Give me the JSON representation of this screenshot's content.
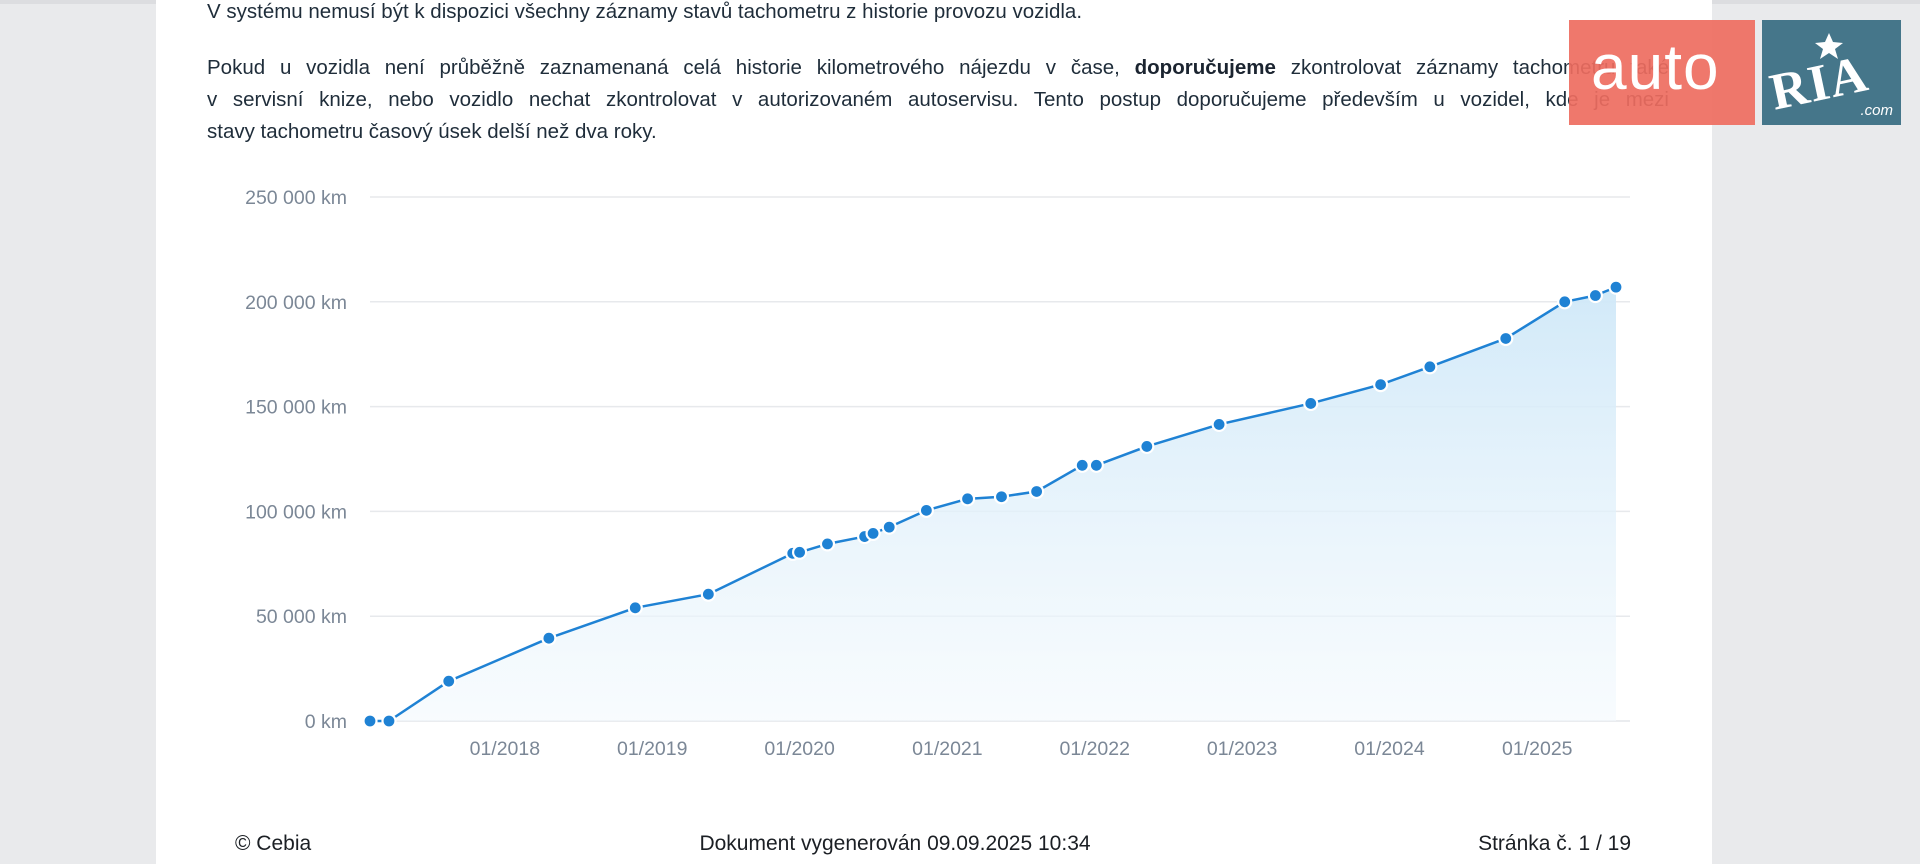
{
  "document": {
    "paragraph1": "V systému nemusí být k dispozici všechny záznamy stavů tachometru z historie provozu vozidla.",
    "paragraph2": {
      "line1_start": "Pokud u vozidla není průběžně zaznamenaná celá historie kilometrového nájezdu v čase, ",
      "line1_bold": "doporučujeme",
      "line1_end": " zkontrolovat záznamy tachometru také",
      "line2": "v servisní knize, nebo vozidlo nechat zkontrolovat v autorizovaném autoservisu. Tento postup doporučujeme především u vozidel, kde je mezi",
      "line3": "stavy tachometru časový úsek delší než dva roky."
    }
  },
  "chart_data": {
    "type": "area",
    "y_unit": "km",
    "ylim": [
      0,
      250000
    ],
    "y_ticks": [
      0,
      50000,
      100000,
      150000,
      200000,
      250000
    ],
    "y_tick_labels": [
      "0 km",
      "50 000 km",
      "100 000 km",
      "150 000 km",
      "200 000 km",
      "250 000 km"
    ],
    "xlim": [
      "2017-02-01",
      "2025-07-15"
    ],
    "x_tick_labels": [
      "01/2018",
      "01/2019",
      "01/2020",
      "01/2021",
      "01/2022",
      "01/2023",
      "01/2024",
      "01/2025"
    ],
    "x_ticks": [
      "2018-01-01",
      "2019-01-01",
      "2020-01-01",
      "2021-01-01",
      "2022-01-01",
      "2023-01-01",
      "2024-01-01",
      "2025-01-01"
    ],
    "grid": true,
    "colors": {
      "line": "#1f82d4",
      "fill": "#d4ecf9"
    },
    "points": [
      {
        "x": "2017-02-01",
        "y": 0
      },
      {
        "x": "2017-03-20",
        "y": 0
      },
      {
        "x": "2017-08-15",
        "y": 19000
      },
      {
        "x": "2018-04-20",
        "y": 39500
      },
      {
        "x": "2018-11-20",
        "y": 54000
      },
      {
        "x": "2019-05-20",
        "y": 60500
      },
      {
        "x": "2019-12-15",
        "y": 80000
      },
      {
        "x": "2020-01-01",
        "y": 80500
      },
      {
        "x": "2020-03-10",
        "y": 84500
      },
      {
        "x": "2020-06-10",
        "y": 88000
      },
      {
        "x": "2020-07-01",
        "y": 89500
      },
      {
        "x": "2020-08-10",
        "y": 92500
      },
      {
        "x": "2020-11-10",
        "y": 100500
      },
      {
        "x": "2021-02-20",
        "y": 106000
      },
      {
        "x": "2021-05-15",
        "y": 107000
      },
      {
        "x": "2021-08-10",
        "y": 109500
      },
      {
        "x": "2021-12-01",
        "y": 122000
      },
      {
        "x": "2022-01-05",
        "y": 122000
      },
      {
        "x": "2022-05-10",
        "y": 131000
      },
      {
        "x": "2022-11-05",
        "y": 141500
      },
      {
        "x": "2023-06-20",
        "y": 151500
      },
      {
        "x": "2023-12-10",
        "y": 160500
      },
      {
        "x": "2024-04-10",
        "y": 169000
      },
      {
        "x": "2024-10-15",
        "y": 182500
      },
      {
        "x": "2025-03-10",
        "y": 200000
      },
      {
        "x": "2025-05-25",
        "y": 203000
      },
      {
        "x": "2025-07-15",
        "y": 207000
      }
    ]
  },
  "footer": {
    "copyright": "© Cebia",
    "generated": "Dokument vygenerován 09.09.2025 10:34",
    "page": "Stránka č. 1 / 19"
  },
  "watermark": {
    "auto": "auto",
    "ria": "RIA",
    "com": ".com"
  }
}
